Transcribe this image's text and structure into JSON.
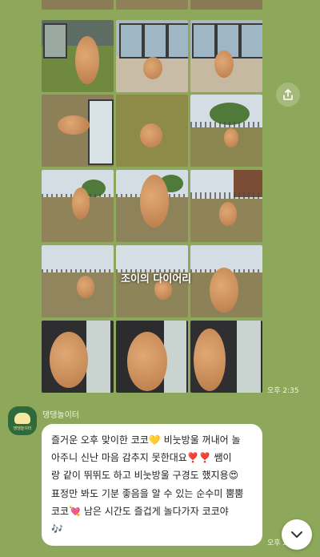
{
  "photos": {
    "caption": "조이의 다이어리",
    "timestamp": "오후 2:35"
  },
  "message": {
    "sender": "댕댕놀이터",
    "avatar_text": "댕댕놀이터",
    "lines": [
      "즐거운 오후 맞이한 코코💛 비눗방울 꺼내어 놀",
      "아주니 신난 마음 감추지 못한대요❣️❣️ 쌤이",
      "랑 같이 뛰뛰도 하고 비눗방울 구경도 했지용😍",
      "표정만 봐도 기분 좋음을 알 수 있는 순수미 뿜뿜",
      "코코💘 남은 시간도 즐겁게 놀다가자 코코야",
      "🎶"
    ],
    "timestamp": "오후 2:35"
  },
  "icons": {
    "share": "share-icon",
    "scroll_down": "chevron-down-icon"
  },
  "colors": {
    "background": "#8da85a",
    "bubble": "#ffffff",
    "avatar": "#2f6a3c"
  }
}
